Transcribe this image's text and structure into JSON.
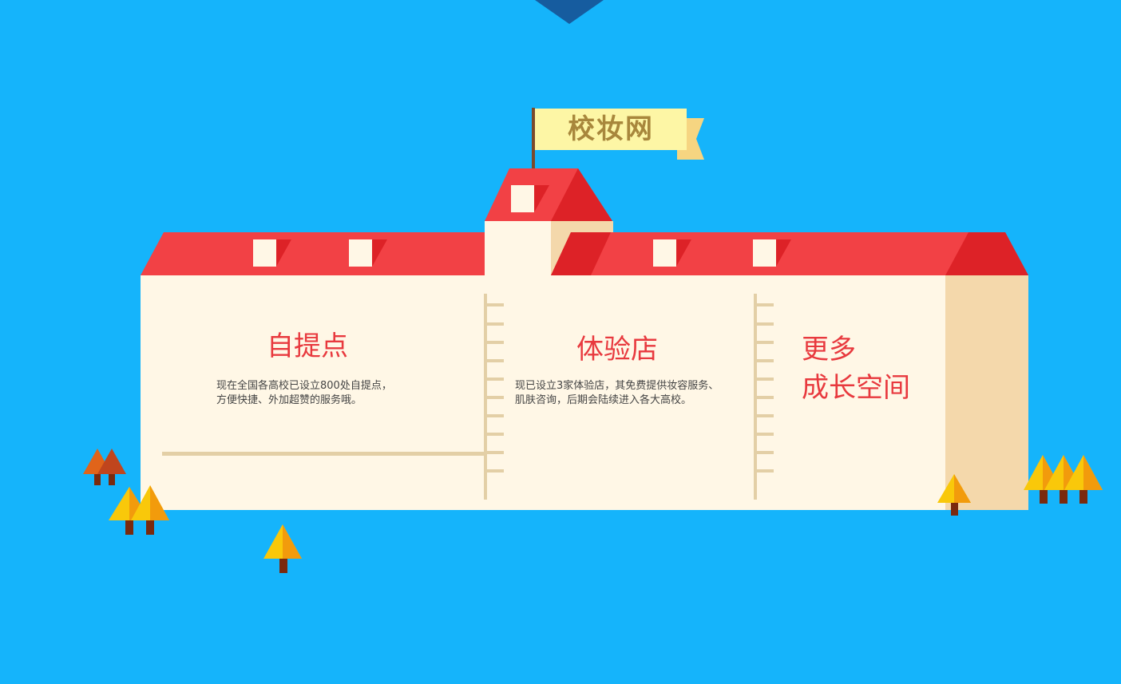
{
  "flag": {
    "label": "校妆网"
  },
  "sections": [
    {
      "title": "自提点",
      "desc_lines": [
        "现在全国各高校已设立800处自提点，",
        "方便快捷、外加超赞的服务哦。"
      ]
    },
    {
      "title": "体验店",
      "desc_lines": [
        "现已设立3家体验店，其免费提供妆容服务、",
        "肌肤咨询，后期会陆续进入各大高校。"
      ]
    },
    {
      "title_lines": [
        "更多",
        "成长空间"
      ]
    }
  ],
  "colors": {
    "background": "#15b4fb",
    "roof": "#f24145",
    "roof_dark": "#dd2227",
    "wall": "#fff7e6",
    "wall_side": "#f4d8ab",
    "flag": "#fdf6a5",
    "flag_text": "#a8873c",
    "heading": "#e8393e",
    "tree_yellow": "#f9c80a",
    "tree_orange": "#f29b0c",
    "tree_brown": "#c0451d",
    "trunk": "#7a2a0e"
  },
  "icons": [
    "school-building-illustration",
    "flag-icon",
    "tree-icon",
    "ladder-icon"
  ]
}
